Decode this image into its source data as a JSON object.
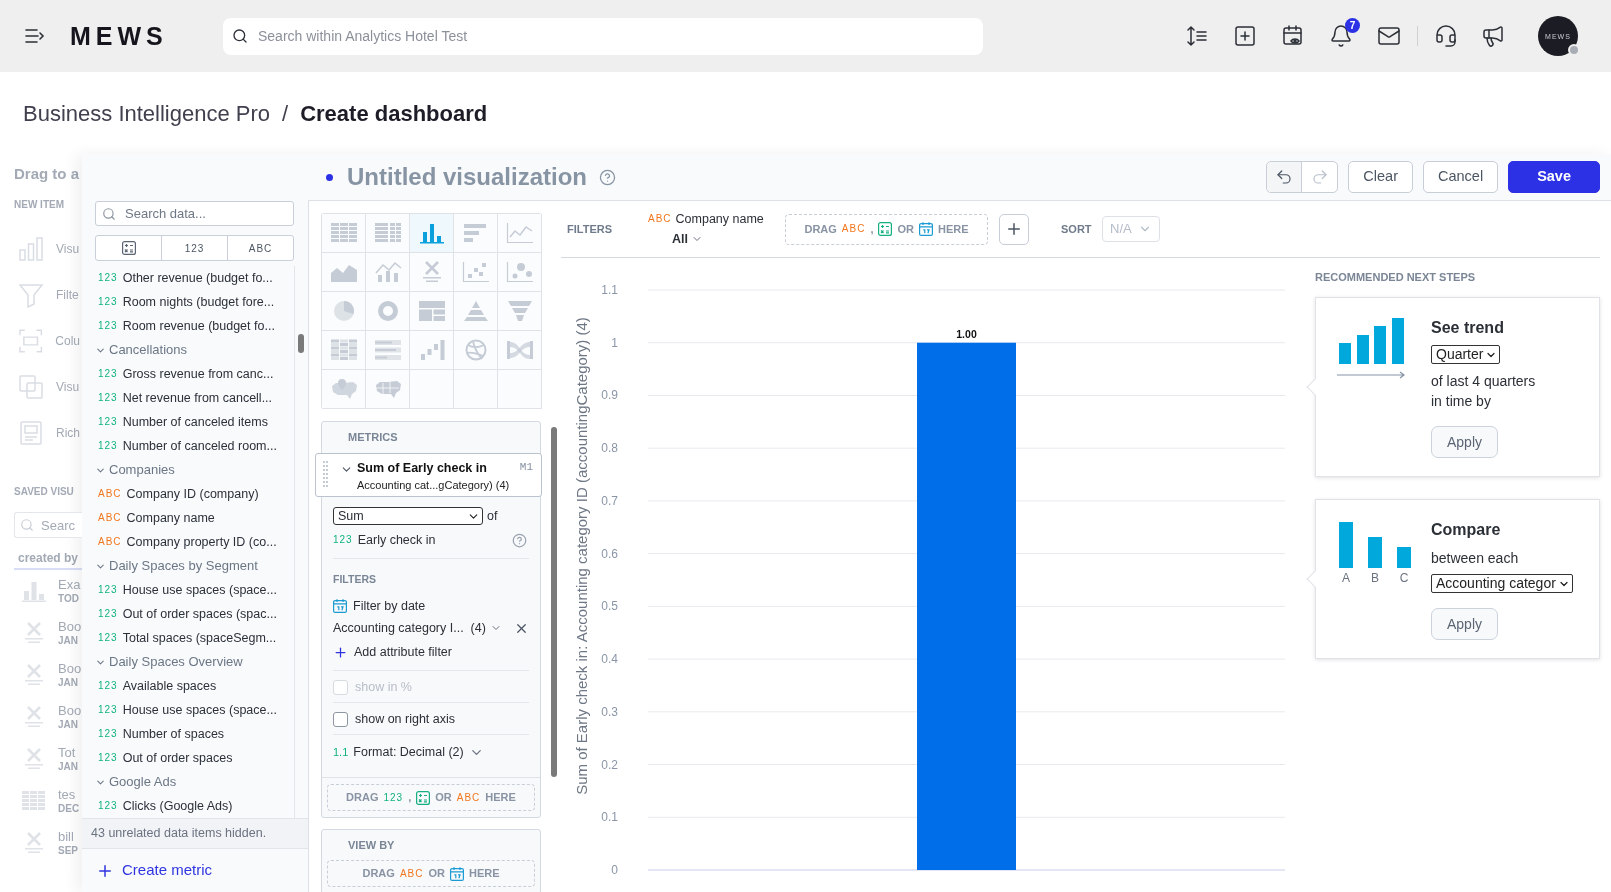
{
  "top_bar": {
    "logo": "MEWS",
    "search": {
      "placeholder": "Search within Analytics Hotel Test"
    },
    "notification_count": "7",
    "avatar_label": "MEWS"
  },
  "breadcrumb": {
    "items": [
      "Business Intelligence Pro",
      "Create dashboard"
    ],
    "separator": "/"
  },
  "dashboard_sidebar": {
    "title": "Drag to a",
    "new_item_heading": "NEW ITEM",
    "new_items": [
      {
        "kind": "visualization",
        "label": "Visu"
      },
      {
        "kind": "filter",
        "label": "Filte"
      },
      {
        "kind": "columns",
        "label": "Colu"
      },
      {
        "kind": "copy",
        "label": "Visu"
      },
      {
        "kind": "rich-text",
        "label": "Rich"
      }
    ],
    "saved_heading": "SAVED VISU",
    "search": {
      "placeholder": "Searc"
    },
    "tabs": [
      {
        "label": "created by",
        "selected": true
      }
    ],
    "saved_items": [
      {
        "kind": "column",
        "name": "Exa",
        "date": "TOD"
      },
      {
        "kind": "headline",
        "name": "Boo",
        "date": "JAN"
      },
      {
        "kind": "headline",
        "name": "Boo",
        "date": "JAN"
      },
      {
        "kind": "headline",
        "name": "Boo",
        "date": "JAN"
      },
      {
        "kind": "headline",
        "name": "Tot",
        "date": "JAN"
      },
      {
        "kind": "table",
        "name": "tes",
        "date": "DEC"
      },
      {
        "kind": "headline",
        "name": "bill",
        "date": "SEP"
      }
    ]
  },
  "data_panel": {
    "search": {
      "placeholder": "Search data..."
    },
    "type_tabs": [
      {
        "kind": "icon",
        "selected": false
      },
      {
        "kind": "text",
        "label": "123",
        "selected": false
      },
      {
        "kind": "text",
        "label": "ABC",
        "selected": false
      }
    ],
    "list": [
      {
        "kind": "metric",
        "badge": "123",
        "label": "Other revenue (budget fo..."
      },
      {
        "kind": "metric",
        "badge": "123",
        "label": "Room nights (budget fore..."
      },
      {
        "kind": "metric",
        "badge": "123",
        "label": "Room revenue (budget fo..."
      },
      {
        "kind": "group",
        "label": "Cancellations",
        "expanded": true,
        "children": [
          {
            "kind": "metric",
            "badge": "123",
            "label": "Gross revenue from canc..."
          },
          {
            "kind": "metric",
            "badge": "123",
            "label": "Net revenue from cancell..."
          },
          {
            "kind": "metric",
            "badge": "123",
            "label": "Number of canceled items"
          },
          {
            "kind": "metric",
            "badge": "123",
            "label": "Number of canceled room..."
          }
        ]
      },
      {
        "kind": "group",
        "label": "Companies",
        "expanded": true,
        "children": [
          {
            "kind": "attribute",
            "badge": "ABC",
            "label": "Company ID (company)"
          },
          {
            "kind": "attribute",
            "badge": "ABC",
            "label": "Company name"
          },
          {
            "kind": "attribute",
            "badge": "ABC",
            "label": "Company property ID (co..."
          }
        ]
      },
      {
        "kind": "group",
        "label": "Daily Spaces by Segment",
        "expanded": true,
        "children": [
          {
            "kind": "metric",
            "badge": "123",
            "label": "House use spaces (space..."
          },
          {
            "kind": "metric",
            "badge": "123",
            "label": "Out of order spaces (spac..."
          },
          {
            "kind": "metric",
            "badge": "123",
            "label": "Total spaces (spaceSegm..."
          }
        ]
      },
      {
        "kind": "group",
        "label": "Daily Spaces Overview",
        "expanded": true,
        "children": [
          {
            "kind": "metric",
            "badge": "123",
            "label": "Available spaces"
          },
          {
            "kind": "metric",
            "badge": "123",
            "label": "House use spaces (space..."
          },
          {
            "kind": "metric",
            "badge": "123",
            "label": "Number of spaces"
          },
          {
            "kind": "metric",
            "badge": "123",
            "label": "Out of order spaces"
          }
        ]
      },
      {
        "kind": "group",
        "label": "Google Ads",
        "expanded": true,
        "children": [
          {
            "kind": "metric",
            "badge": "123",
            "label": "Clicks (Google Ads)"
          }
        ]
      }
    ],
    "hidden_note": "43 unrelated data items hidden.",
    "create_metric": "Create metric"
  },
  "visualization": {
    "title": "Untitled visualization",
    "unsaved": true,
    "toolbar": {
      "undo": {
        "disabled": false
      },
      "redo": {
        "disabled": true
      },
      "buttons": [
        {
          "kind": "secondary",
          "label": "Clear"
        },
        {
          "kind": "secondary",
          "label": "Cancel"
        },
        {
          "kind": "primary",
          "label": "Save"
        }
      ]
    },
    "chart_types": [
      {
        "kind": "table",
        "selected": false
      },
      {
        "kind": "pivot-table",
        "selected": false
      },
      {
        "kind": "column",
        "selected": true
      },
      {
        "kind": "bar",
        "selected": false
      },
      {
        "kind": "line",
        "selected": false
      },
      {
        "kind": "area",
        "selected": false
      },
      {
        "kind": "combo",
        "selected": false
      },
      {
        "kind": "headline",
        "selected": false
      },
      {
        "kind": "scatter",
        "selected": false
      },
      {
        "kind": "bubble",
        "selected": false
      },
      {
        "kind": "pie",
        "selected": false
      },
      {
        "kind": "donut",
        "selected": false
      },
      {
        "kind": "treemap",
        "selected": false
      },
      {
        "kind": "pyramid",
        "selected": false
      },
      {
        "kind": "funnel",
        "selected": false
      },
      {
        "kind": "heatmap",
        "selected": false
      },
      {
        "kind": "bullet",
        "selected": false
      },
      {
        "kind": "waterfall",
        "selected": false
      },
      {
        "kind": "dependency-wheel",
        "selected": false
      },
      {
        "kind": "sankey",
        "selected": false
      },
      {
        "kind": "pushpin-map",
        "selected": false
      },
      {
        "kind": "region-map",
        "selected": false
      }
    ],
    "metrics": {
      "heading": "METRICS",
      "items": [
        {
          "title": "Sum of Early check in",
          "subtitle": "Accounting cat...gCategory) (4)",
          "tag": "M1",
          "expanded": true,
          "aggregation": "Sum",
          "of_label": "of",
          "measure": {
            "kind": "metric",
            "badge": "123",
            "label": "Early check in"
          },
          "filters_heading": "FILTERS",
          "date_filter": "Filter by date",
          "attribute_filters": [
            {
              "label": "Accounting category I...  (4)"
            }
          ],
          "add_filter": "Add attribute filter",
          "options": [
            {
              "label": "show in %",
              "checked": false,
              "disabled": true
            },
            {
              "label": "show on right axis",
              "checked": false,
              "disabled": false
            }
          ],
          "format": {
            "badge": "1.1",
            "label": "Format: Decimal (2)"
          }
        }
      ],
      "drop_zone": [
        {
          "kind": "word",
          "text": "DRAG"
        },
        {
          "kind": "metric",
          "text": "123"
        },
        {
          "kind": "word",
          "text": ","
        },
        {
          "kind": "calc-icon"
        },
        {
          "kind": "word",
          "text": "OR"
        },
        {
          "kind": "attribute",
          "text": "ABC"
        },
        {
          "kind": "word",
          "text": "HERE"
        }
      ]
    },
    "view_by": {
      "heading": "VIEW BY",
      "drop_zone": [
        {
          "kind": "word",
          "text": "DRAG"
        },
        {
          "kind": "attribute",
          "text": "ABC"
        },
        {
          "kind": "word",
          "text": "OR"
        },
        {
          "kind": "date-icon"
        },
        {
          "kind": "word",
          "text": "HERE"
        }
      ]
    },
    "filter_bar": {
      "label": "FILTERS",
      "filters": [
        {
          "kind": "attribute",
          "badge": "ABC",
          "label": "Company name",
          "value": "All"
        }
      ],
      "drop_zone": [
        {
          "kind": "word",
          "text": "DRAG"
        },
        {
          "kind": "attribute",
          "text": "ABC"
        },
        {
          "kind": "word",
          "text": ","
        },
        {
          "kind": "calc-icon"
        },
        {
          "kind": "word",
          "text": "OR"
        },
        {
          "kind": "date-icon"
        },
        {
          "kind": "word",
          "text": "HERE"
        }
      ],
      "sort_label": "SORT",
      "sort": {
        "value": "N/A",
        "disabled": true
      }
    },
    "chart_data": {
      "type": "bar",
      "ylabel": "Sum of Early check in: Accounting category ID (accountingCategory) (4)",
      "series": [
        {
          "color": "#006ee8",
          "values": [
            1
          ]
        }
      ],
      "ylim": [
        0,
        1.1
      ],
      "yticks": [
        0,
        0.1,
        0.2,
        0.3,
        0.4,
        0.5,
        0.6,
        0.7,
        0.8,
        0.9,
        1,
        1.1
      ],
      "grid": true,
      "value_labels": [
        "1.00"
      ]
    },
    "recommendations": {
      "heading": "RECOMMENDED NEXT STEPS",
      "cards": [
        {
          "kind": "trend",
          "title": "See trend",
          "select": "Quarter",
          "text": "of last 4 quarters in time by",
          "button": "Apply"
        },
        {
          "kind": "compare",
          "title": "Compare",
          "text": "between each",
          "select": "Accounting categor",
          "labels": [
            "A",
            "B",
            "C"
          ],
          "button": "Apply"
        }
      ]
    }
  }
}
